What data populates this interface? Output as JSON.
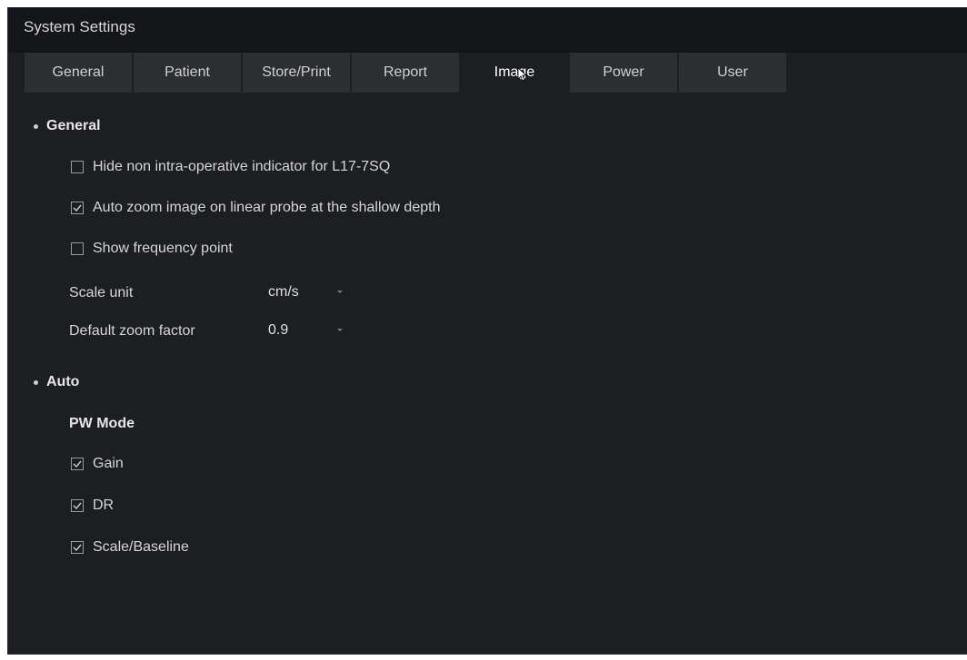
{
  "window": {
    "title": "System Settings"
  },
  "tabs": [
    {
      "label": "General"
    },
    {
      "label": "Patient"
    },
    {
      "label": "Store/Print"
    },
    {
      "label": "Report"
    },
    {
      "label": "Image",
      "active": true
    },
    {
      "label": "Power"
    },
    {
      "label": "User"
    }
  ],
  "general": {
    "heading": "General",
    "options": [
      {
        "label": "Hide non intra-operative indicator for L17-7SQ",
        "checked": false
      },
      {
        "label": "Auto zoom image on linear probe at the shallow depth",
        "checked": true
      },
      {
        "label": "Show frequency point",
        "checked": false
      }
    ],
    "scale_unit": {
      "label": "Scale unit",
      "value": "cm/s"
    },
    "zoom_factor": {
      "label": "Default zoom factor",
      "value": "0.9"
    }
  },
  "auto": {
    "heading": "Auto",
    "pw_mode": {
      "heading": "PW Mode",
      "options": [
        {
          "label": "Gain",
          "checked": true
        },
        {
          "label": "DR",
          "checked": true
        },
        {
          "label": "Scale/Baseline",
          "checked": true
        }
      ]
    }
  },
  "colors": {
    "background": "#1c1e21",
    "tab": "#2c2e32",
    "titlebar": "#141518"
  }
}
